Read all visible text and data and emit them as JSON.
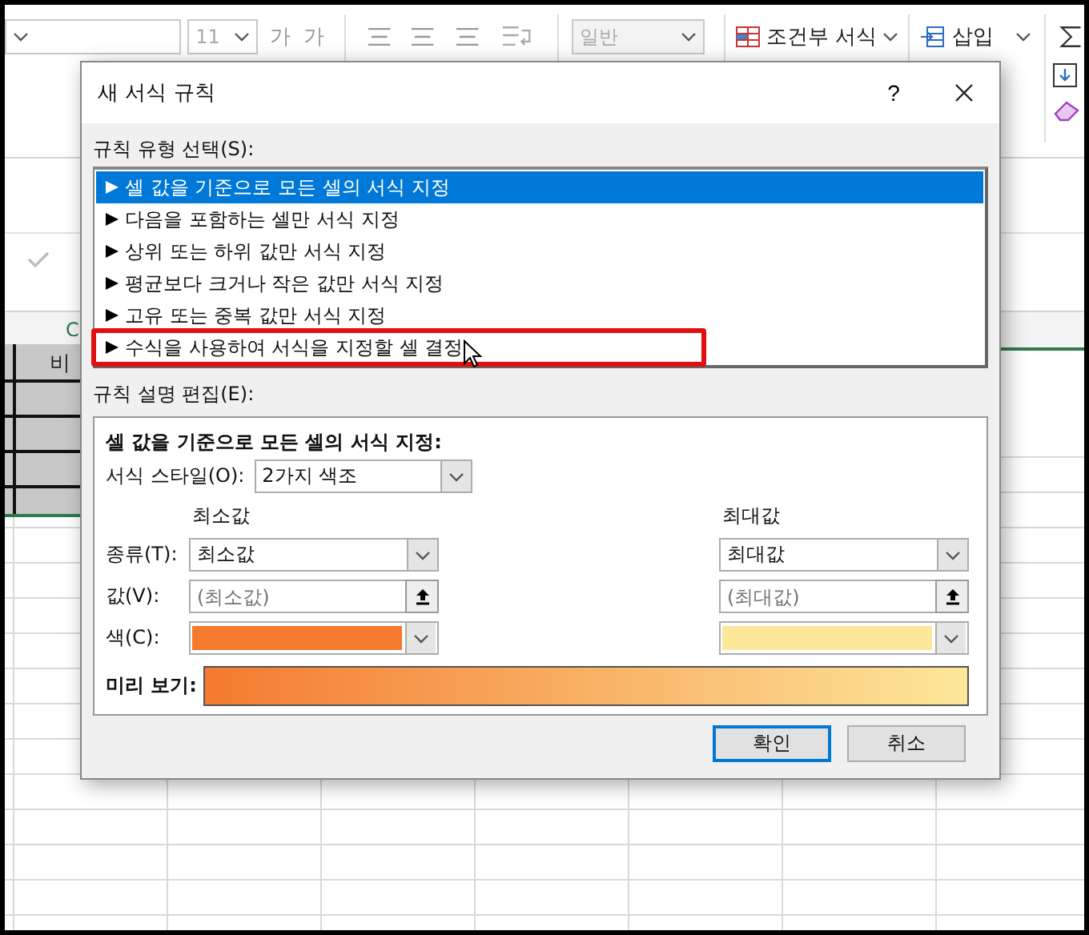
{
  "ribbon": {
    "font_size": "11",
    "grow_font": "가",
    "shrink_font": "가",
    "number_format": "일반",
    "conditional_format": "조건부 서식",
    "insert": "삽입"
  },
  "sheet": {
    "column_header": "C",
    "cell_text": "비"
  },
  "dialog": {
    "title": "새 서식 규칙",
    "help": "?",
    "rule_type_label": "규칙 유형 선택(S):",
    "rule_types": [
      {
        "label": "셀 값을 기준으로 모든 셀의 서식 지정",
        "selected": true,
        "highlighted": false
      },
      {
        "label": "다음을 포함하는 셀만 서식 지정",
        "selected": false,
        "highlighted": false
      },
      {
        "label": "상위 또는 하위 값만 서식 지정",
        "selected": false,
        "highlighted": false
      },
      {
        "label": "평균보다 크거나 작은 값만 서식 지정",
        "selected": false,
        "highlighted": false
      },
      {
        "label": "고유 또는 중복 값만 서식 지정",
        "selected": false,
        "highlighted": false
      },
      {
        "label": "수식을 사용하여 서식을 지정할 셀 결정",
        "selected": false,
        "highlighted": true
      }
    ],
    "edit_label": "규칙 설명 편집(E):",
    "description": {
      "title": "셀 값을 기준으로 모든 셀의 서식 지정:",
      "style_label": "서식 스타일(O):",
      "style_value": "2가지 색조",
      "type_label": "종류(T):",
      "value_label": "값(V):",
      "color_label": "색(C):",
      "points": [
        {
          "header": "최소값",
          "type": "최소값",
          "placeholder": "(최소값)",
          "color": "#f47a30"
        },
        {
          "header": "최대값",
          "type": "최대값",
          "placeholder": "(최대값)",
          "color": "#fde79a"
        }
      ],
      "preview_label": "미리 보기:"
    },
    "buttons": [
      {
        "label": "확인",
        "default": true
      },
      {
        "label": "취소",
        "default": false
      }
    ]
  }
}
